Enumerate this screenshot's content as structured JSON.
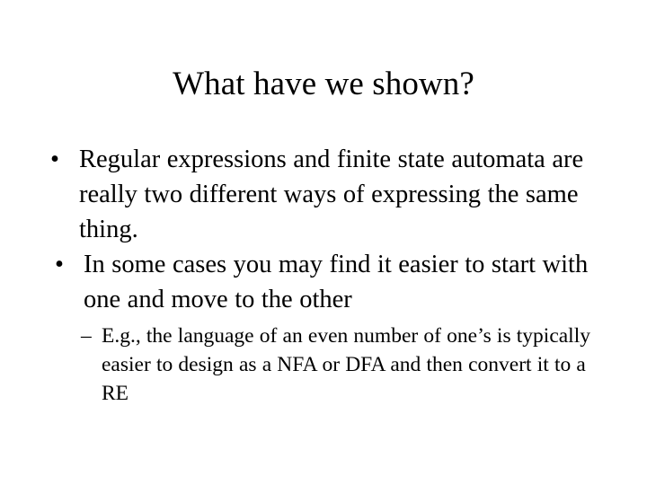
{
  "slide": {
    "title": "What have we shown?",
    "background_color": "#ffffff",
    "text_color": "#000000",
    "bullets": [
      {
        "level": 1,
        "marker": "•",
        "marker_name": "bullet-dot",
        "text": "Regular expressions and finite state automata are really two different ways of expressing the same thing."
      },
      {
        "level": 1,
        "marker": "•",
        "marker_name": "bullet-dot",
        "text": "In some cases you may find it easier to start with one and move to the other"
      },
      {
        "level": 2,
        "marker": "–",
        "marker_name": "bullet-dash",
        "text": "E.g., the language of an even number of one’s is typically easier to design as a NFA or DFA and then convert it to a RE"
      }
    ]
  }
}
